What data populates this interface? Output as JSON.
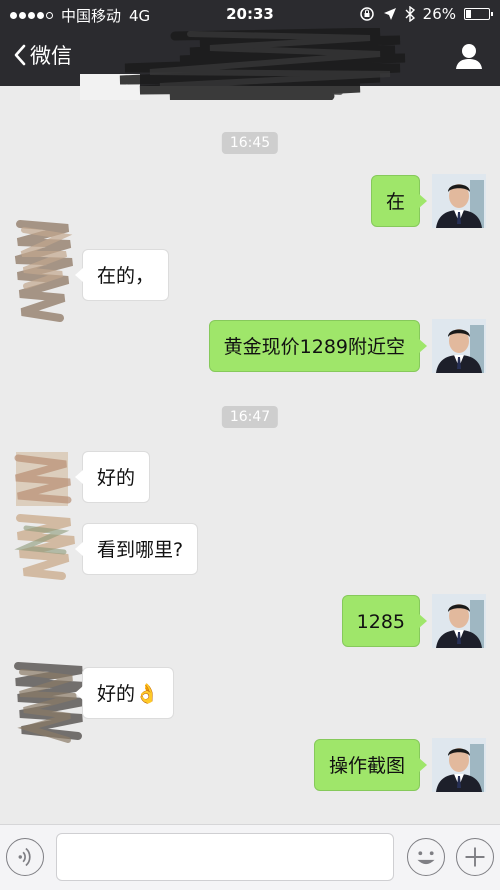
{
  "status_bar": {
    "carrier": "中国移动",
    "network": "4G",
    "time": "20:33",
    "battery_percent": "26%",
    "battery_level": 0.26
  },
  "nav": {
    "back_label": "微信"
  },
  "messages": [
    {
      "kind": "timestamp",
      "text": "16:45"
    },
    {
      "kind": "sent",
      "text": "在"
    },
    {
      "kind": "received",
      "text": "在的，"
    },
    {
      "kind": "sent",
      "text": "黄金现价1289附近空"
    },
    {
      "kind": "timestamp",
      "text": "16:47"
    },
    {
      "kind": "received",
      "text": "好的"
    },
    {
      "kind": "received",
      "text": "看到哪里?"
    },
    {
      "kind": "sent",
      "text": "1285"
    },
    {
      "kind": "received",
      "text": "好的👌"
    },
    {
      "kind": "sent",
      "text": "操作截图"
    }
  ],
  "input_bar": {
    "message_value": "",
    "voice_icon": "voice-icon",
    "emoji_icon": "emoji-icon",
    "plus_icon": "plus-icon"
  },
  "colors": {
    "sent_bubble": "#9fe66a",
    "received_bubble": "#ffffff",
    "background": "#ebebeb",
    "top_bar": "#2b2b2f"
  }
}
